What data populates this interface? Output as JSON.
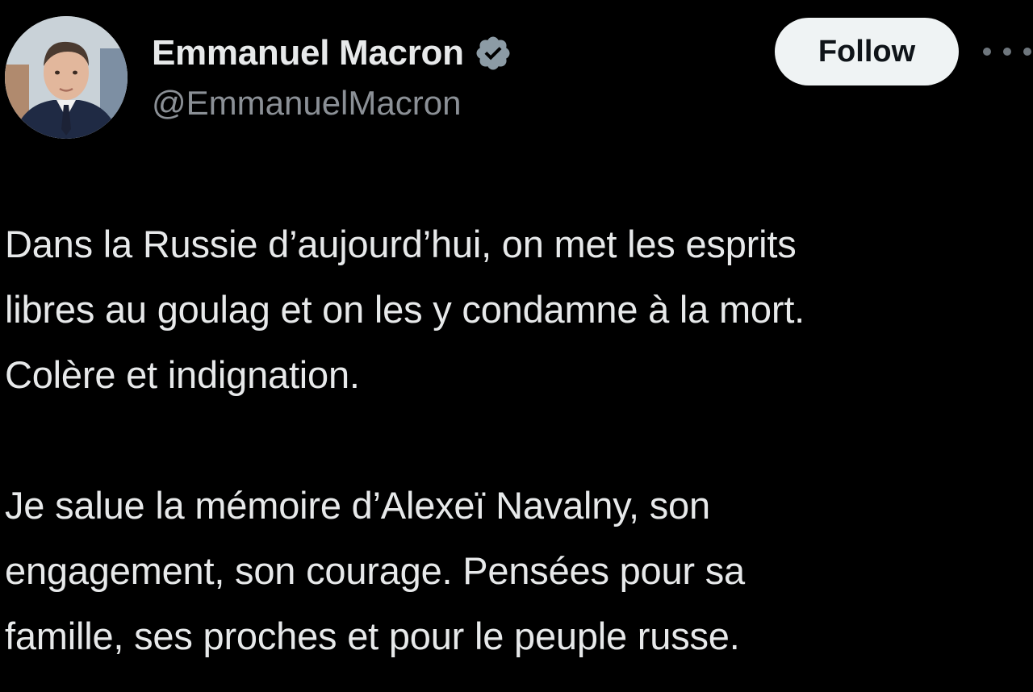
{
  "author": {
    "display_name": "Emmanuel Macron",
    "handle": "@EmmanuelMacron",
    "verified_icon": "verified-badge-icon",
    "avatar_icon": "profile-photo"
  },
  "follow_button": {
    "label": "Follow"
  },
  "more_icon": "more-horizontal-icon",
  "tweet": {
    "paragraph_1": [
      "Dans la Russie d’aujourd’hui, on met les esprits",
      "libres au goulag et on les y condamne à la mort.",
      "Colère et indignation."
    ],
    "paragraph_2": [
      "Je salue la mémoire d’Alexeï Navalny, son",
      "engagement, son courage. Pensées pour sa",
      "famille, ses proches et pour le peuple russe."
    ]
  },
  "colors": {
    "background": "#000000",
    "text_primary": "#e7e9ea",
    "text_secondary": "#8b9096",
    "follow_bg": "#eff3f4",
    "follow_text": "#0f1419",
    "verified": "#8c9ba5"
  }
}
